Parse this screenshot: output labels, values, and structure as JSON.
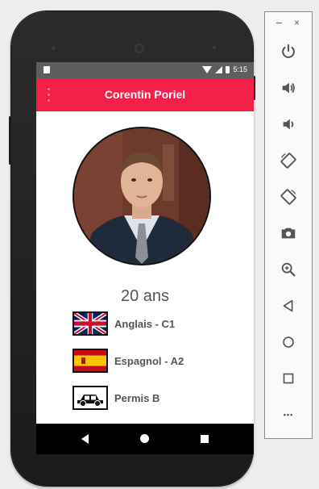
{
  "status_bar": {
    "time": "5:15"
  },
  "app_bar": {
    "title": "Corentin Poriel"
  },
  "profile": {
    "age": "20 ans",
    "items": [
      {
        "label": "Anglais - C1",
        "icon": "uk-flag-icon"
      },
      {
        "label": "Espagnol - A2",
        "icon": "spain-flag-icon"
      },
      {
        "label": "Permis B",
        "icon": "car-icon"
      }
    ]
  },
  "emulator_toolbar": {
    "buttons": [
      "power-icon",
      "volume-up-icon",
      "volume-down-icon",
      "rotate-left-icon",
      "rotate-right-icon",
      "camera-icon",
      "zoom-icon",
      "back-icon",
      "home-icon",
      "overview-icon",
      "more-icon"
    ],
    "minimize": "−",
    "close": "×",
    "more": "•••"
  },
  "colors": {
    "accent": "#f4204a",
    "status_bar": "#5e5e5e",
    "nav_bar": "#000000",
    "text": "#555555"
  }
}
